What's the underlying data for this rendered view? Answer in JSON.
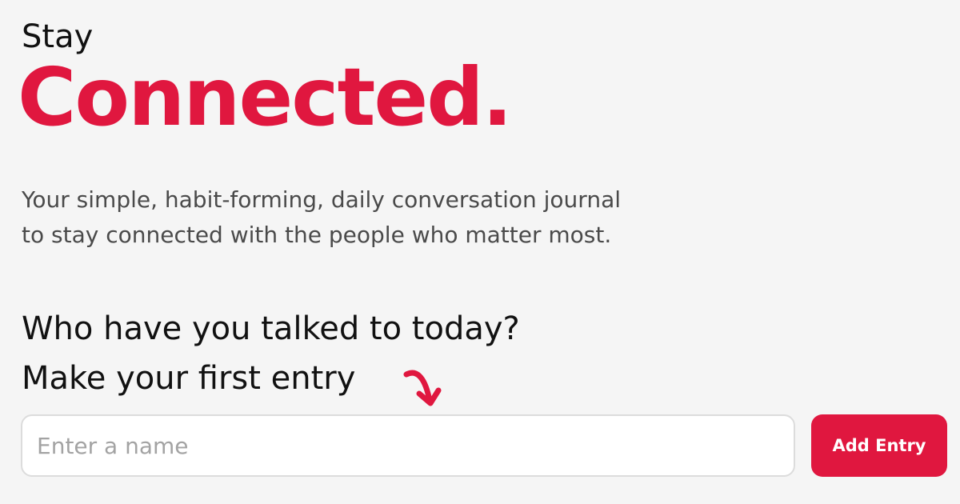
{
  "hero": {
    "eyebrow": "Stay",
    "headline": "Connected.",
    "tagline_line1": "Your simple, habit-forming, daily conversation journal",
    "tagline_line2": "to stay connected with the people who matter most."
  },
  "prompt": {
    "question": "Who have you talked to today?",
    "instruction": "Make your first entry"
  },
  "entry_form": {
    "name_placeholder": "Enter a name",
    "name_value": "",
    "submit_label": "Add Entry"
  },
  "icons": {
    "arrow": "curved-arrow-down-icon"
  },
  "colors": {
    "brand": "#e0173f",
    "background": "#f5f5f5",
    "text": "#111111",
    "muted_text": "#4a4a4a"
  }
}
